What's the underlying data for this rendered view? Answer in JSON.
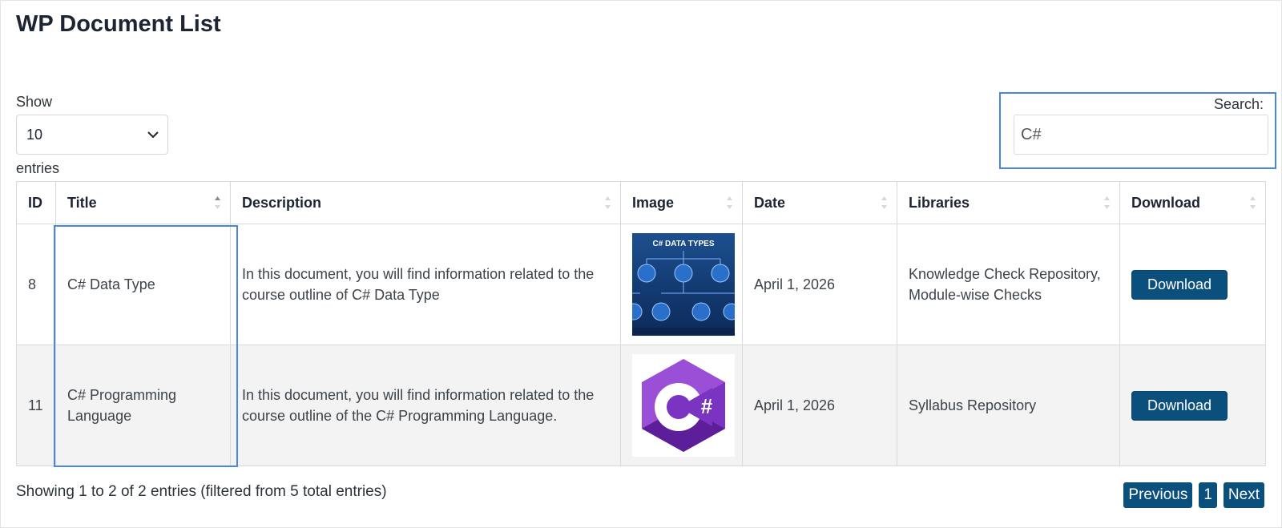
{
  "header": {
    "title": "WP Document List"
  },
  "length_control": {
    "show_label": "Show",
    "selected": "10",
    "entries_label": "entries"
  },
  "search": {
    "label": "Search:",
    "value": "C#"
  },
  "table": {
    "columns": [
      "ID",
      "Title",
      "Description",
      "Image",
      "Date",
      "Libraries",
      "Download"
    ],
    "rows": [
      {
        "id": "8",
        "title": "C# Data Type",
        "description": "In this document, you will find information related to the course outline of C# Data Type",
        "image": {
          "heading": "C# DATA TYPES"
        },
        "date": "April 1, 2026",
        "libraries": "Knowledge Check Repository, Module-wise Checks",
        "download_label": "Download"
      },
      {
        "id": "11",
        "title": "C# Programming Language",
        "description": "In this document, you will find information related to the course outline of the C# Programming Language.",
        "image": {
          "logo_text": "#"
        },
        "date": "April 1, 2026",
        "libraries": "Syllabus Repository",
        "download_label": "Download"
      }
    ]
  },
  "footer": {
    "info": "Showing 1 to 2 of 2 entries (filtered from 5 total entries)",
    "pagination": {
      "previous": "Previous",
      "current_page": "1",
      "next": "Next"
    }
  },
  "colors": {
    "accent": "#0b4f7c",
    "highlight_border": "#4a86e0",
    "stripe": "#f3f3f3"
  }
}
